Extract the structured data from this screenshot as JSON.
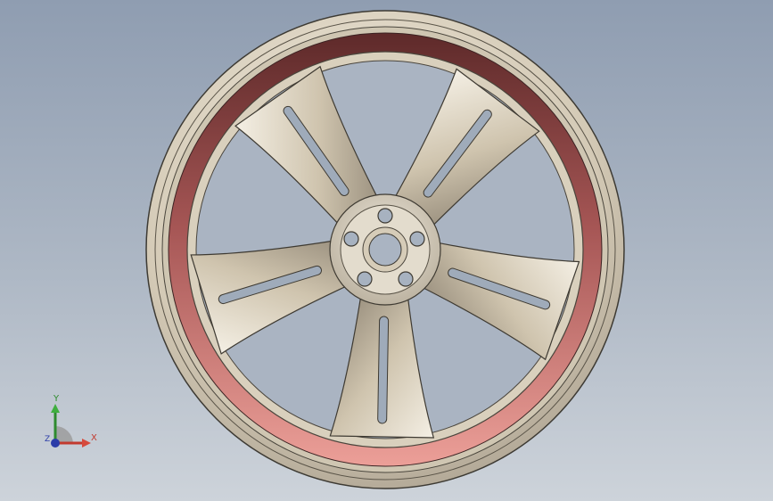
{
  "viewport": {
    "background_top": "#8f9db1",
    "background_bottom": "#cdd3da"
  },
  "model": {
    "spoke_count": 5,
    "lug_hole_count": 5,
    "rim_color": "#d6cdbc",
    "band_color_top": "#6b3030",
    "band_color_bottom": "#e89b94"
  },
  "triad": {
    "x_label": "X",
    "y_label": "Y",
    "z_label": "Z",
    "x_color": "#c23a2e",
    "y_color": "#2e8b2e",
    "z_color": "#2b3ca8",
    "icon": "coordinate-triad-icon"
  }
}
